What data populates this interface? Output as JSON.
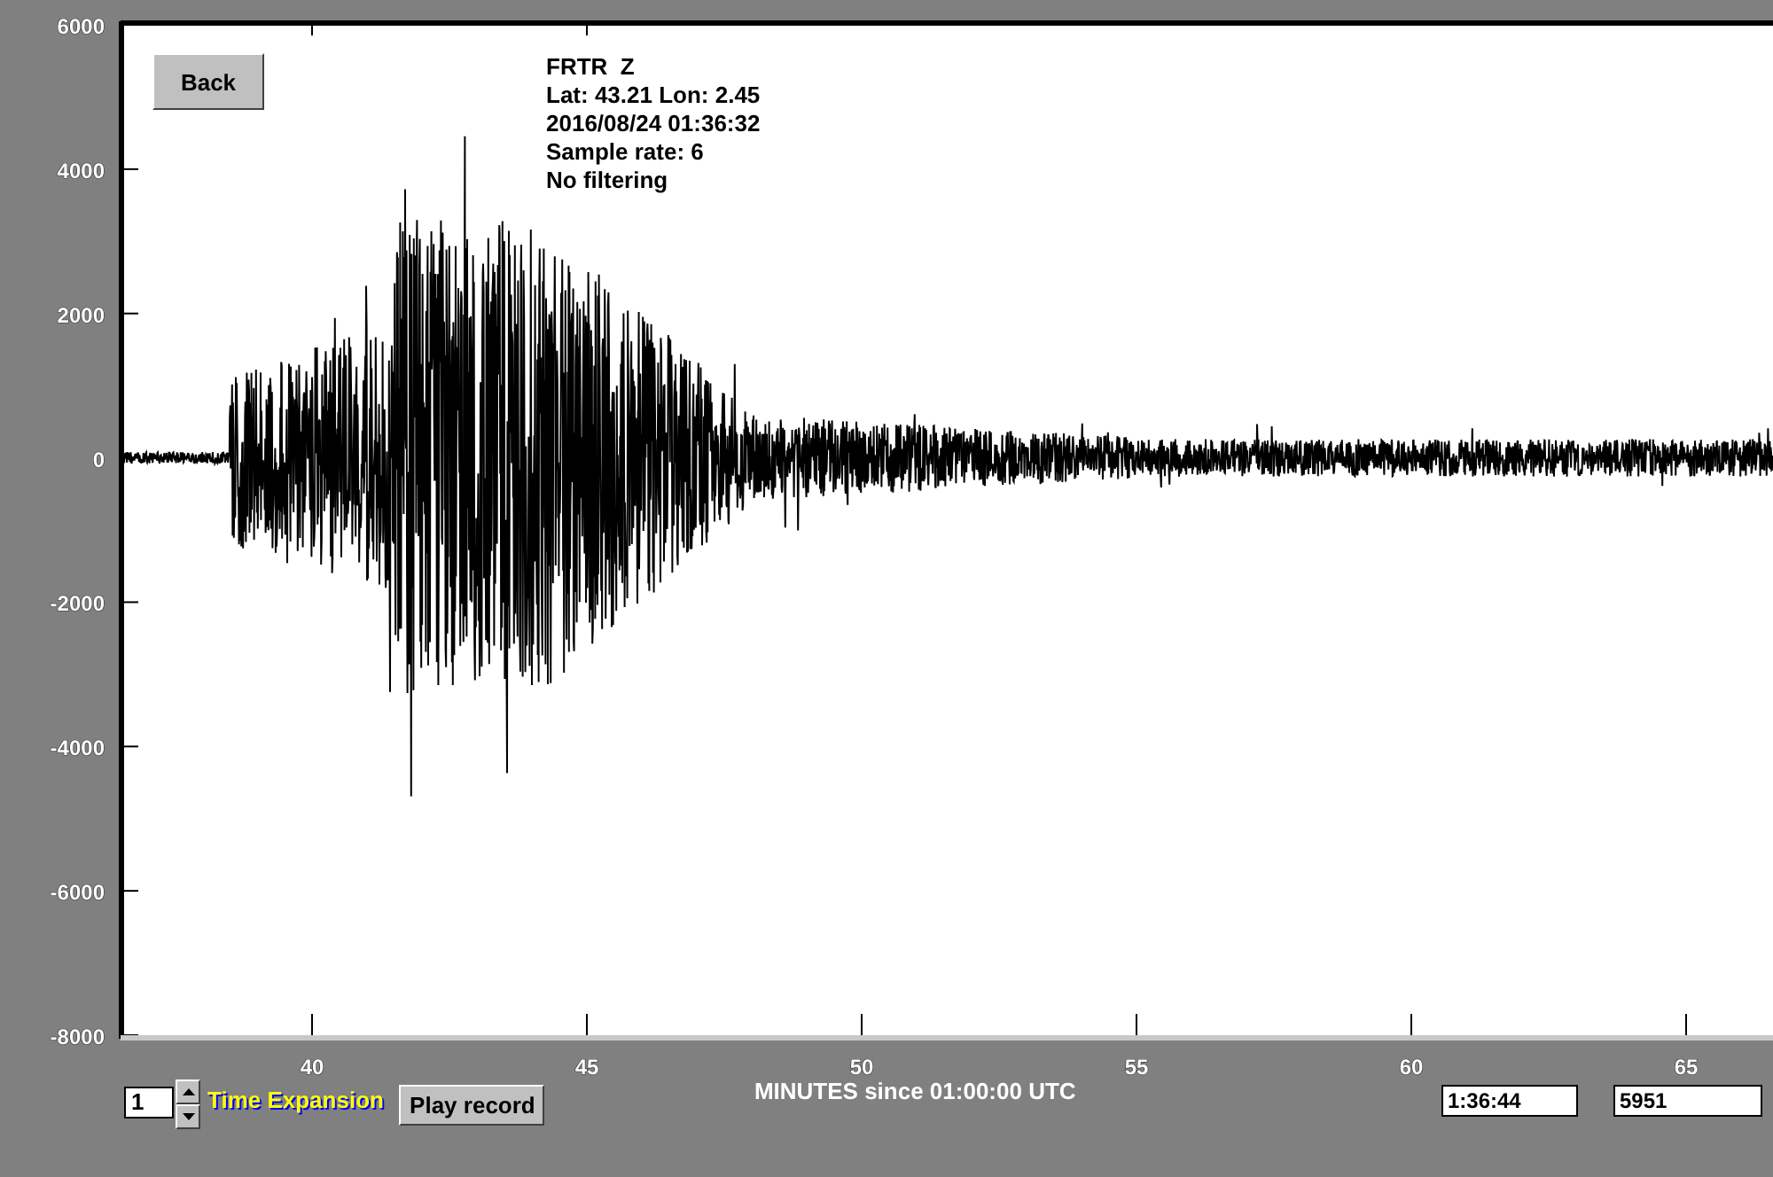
{
  "back_button": "Back",
  "station_info": [
    "FRTR  Z",
    "Lat: 43.21 Lon: 2.45",
    "2016/08/24 01:36:32",
    "Sample rate: 6",
    "No filtering"
  ],
  "y_ticks": [
    "6000",
    "4000",
    "2000",
    "0",
    "-2000",
    "-4000",
    "-6000",
    "-8000"
  ],
  "x_ticks": [
    "40",
    "45",
    "50",
    "55",
    "60",
    "65"
  ],
  "x_axis_label": "MINUTES since 01:00:00 UTC",
  "time_expansion": {
    "value": "1",
    "label": "Time Expansion"
  },
  "play_button": "Play record",
  "time_field": "1:36:44",
  "count_field": "5951"
}
